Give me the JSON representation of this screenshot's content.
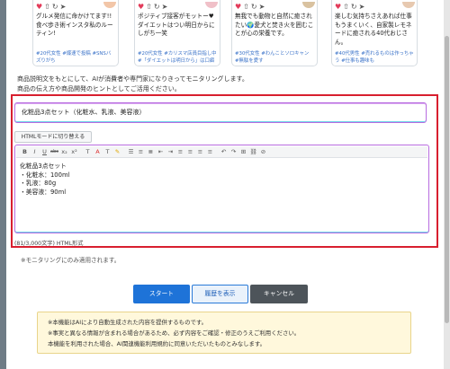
{
  "cards": [
    {
      "text": "グルメ発信に命かけてます!!食べ歩き術インスタ私のルーティン!",
      "tags": "#20代女性 #爆速で投稿 #SNSバズりがち",
      "avatar_color": "#f2c6a8"
    },
    {
      "text": "ポジティブ接客がモットー♥ダイエットはつい明日からにしがち一笑",
      "tags": "#20代女性 #カリスマ店員目指し中 #「ダイエットは明日から」は口癖",
      "avatar_color": "#f0c0c8"
    },
    {
      "text": "無我でも動物と自然に癒されたい🌍愛犬と焚き火を囲むことが心の栄養です。",
      "tags": "#30代女性 #わんことソロキャン #無駄を愛す",
      "avatar_color": "#d9c2a0"
    },
    {
      "text": "楽しむ気持ちさえあれば仕事もうまくいく、自家製レモネードに癒される40代おじさん。",
      "tags": "#40代男性 #売れるものは作っちゃう #仕事も趣味も",
      "avatar_color": "#e7c9b0"
    }
  ],
  "card_icons": [
    "heart-icon",
    "share-icon",
    "repeat-icon",
    "send-icon"
  ],
  "description": {
    "line1": "商品説明文をもとにして、AIが消費者や専門家になりきってモニタリングします。",
    "line2": "商品の伝え方や商品開発のヒントとしてご活用ください。"
  },
  "title_input": {
    "value": "化粧品3点セット（化粧水、乳液、美容液）"
  },
  "html_mode_button": "HTMLモードに切り替える",
  "toolbar_buttons": [
    "B",
    "I",
    "U",
    "abc",
    "x₂",
    "x²",
    "T",
    "A",
    "T",
    "✎",
    "☰",
    "≡",
    "≣",
    "⇤",
    "⇥",
    "≡",
    "≡",
    "≡",
    "≡",
    "↶",
    "↷",
    "⊞",
    "⛓",
    "⊘"
  ],
  "editor_content": [
    "化粧品3点セット",
    "・化粧水：100ml",
    "・乳液：80g",
    "・美容液：90ml"
  ],
  "char_counter": "(81/3,000文字) HTML形式",
  "monitoring_note": "※モニタリングにのみ適用されます。",
  "buttons": {
    "start": "スタート",
    "history": "履歴を表示",
    "cancel": "キャンセル"
  },
  "notice": {
    "line1": "※本機能はAIにより自動生成された内容を提供するものです。",
    "line2": "※事実と異なる情報が含まれる場合があるため、必ず内容をご確認・修正のうえご利用ください。",
    "line3": "本機能を利用された場合、AI関連機能利用規約に同意いただいたものとみなします。"
  },
  "colors": {
    "accent_red": "#d81f2f",
    "primary_blue": "#1e73d8",
    "dark_gray": "#4d545a",
    "notice_bg": "#fff8dc"
  }
}
